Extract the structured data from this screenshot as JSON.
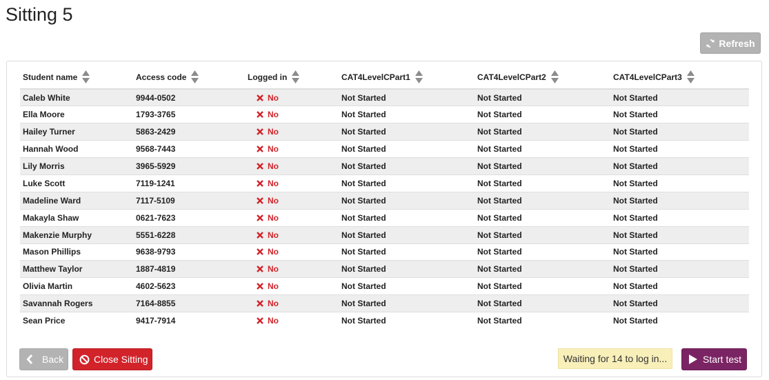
{
  "page": {
    "title": "Sitting 5"
  },
  "toolbar": {
    "refresh_label": "Refresh"
  },
  "table": {
    "headers": {
      "student_name": "Student name",
      "access_code": "Access code",
      "logged_in": "Logged in",
      "part1": "CAT4LevelCPart1",
      "part2": "CAT4LevelCPart2",
      "part3": "CAT4LevelCPart3"
    },
    "rows": [
      {
        "name": "Caleb White",
        "code": "9944-0502",
        "logged_in": "No",
        "p1": "Not Started",
        "p2": "Not Started",
        "p3": "Not Started"
      },
      {
        "name": "Ella Moore",
        "code": "1793-3765",
        "logged_in": "No",
        "p1": "Not Started",
        "p2": "Not Started",
        "p3": "Not Started"
      },
      {
        "name": "Hailey Turner",
        "code": "5863-2429",
        "logged_in": "No",
        "p1": "Not Started",
        "p2": "Not Started",
        "p3": "Not Started"
      },
      {
        "name": "Hannah Wood",
        "code": "9568-7443",
        "logged_in": "No",
        "p1": "Not Started",
        "p2": "Not Started",
        "p3": "Not Started"
      },
      {
        "name": "Lily Morris",
        "code": "3965-5929",
        "logged_in": "No",
        "p1": "Not Started",
        "p2": "Not Started",
        "p3": "Not Started"
      },
      {
        "name": "Luke Scott",
        "code": "7119-1241",
        "logged_in": "No",
        "p1": "Not Started",
        "p2": "Not Started",
        "p3": "Not Started"
      },
      {
        "name": "Madeline Ward",
        "code": "7117-5109",
        "logged_in": "No",
        "p1": "Not Started",
        "p2": "Not Started",
        "p3": "Not Started"
      },
      {
        "name": "Makayla Shaw",
        "code": "0621-7623",
        "logged_in": "No",
        "p1": "Not Started",
        "p2": "Not Started",
        "p3": "Not Started"
      },
      {
        "name": "Makenzie Murphy",
        "code": "5551-6228",
        "logged_in": "No",
        "p1": "Not Started",
        "p2": "Not Started",
        "p3": "Not Started"
      },
      {
        "name": "Mason Phillips",
        "code": "9638-9793",
        "logged_in": "No",
        "p1": "Not Started",
        "p2": "Not Started",
        "p3": "Not Started"
      },
      {
        "name": "Matthew Taylor",
        "code": "1887-4819",
        "logged_in": "No",
        "p1": "Not Started",
        "p2": "Not Started",
        "p3": "Not Started"
      },
      {
        "name": "Olivia Martin",
        "code": "4602-5623",
        "logged_in": "No",
        "p1": "Not Started",
        "p2": "Not Started",
        "p3": "Not Started"
      },
      {
        "name": "Savannah Rogers",
        "code": "7164-8855",
        "logged_in": "No",
        "p1": "Not Started",
        "p2": "Not Started",
        "p3": "Not Started"
      },
      {
        "name": "Sean Price",
        "code": "9417-7914",
        "logged_in": "No",
        "p1": "Not Started",
        "p2": "Not Started",
        "p3": "Not Started"
      }
    ]
  },
  "footer": {
    "back_label": "Back",
    "close_label": "Close Sitting",
    "waiting_text": "Waiting for 14 to log in...",
    "start_label": "Start test"
  },
  "icons": {
    "refresh": "refresh-icon",
    "sort": "sort-icon",
    "not_logged_in": "x-icon",
    "back": "chevron-left-icon",
    "close": "ban-icon",
    "start": "play-icon"
  },
  "colors": {
    "danger": "#d2232a",
    "primary": "#7b2463",
    "disabled": "#b3b3b3",
    "warning_bg": "#f8efb9",
    "row_stripe": "#eeeeee"
  }
}
